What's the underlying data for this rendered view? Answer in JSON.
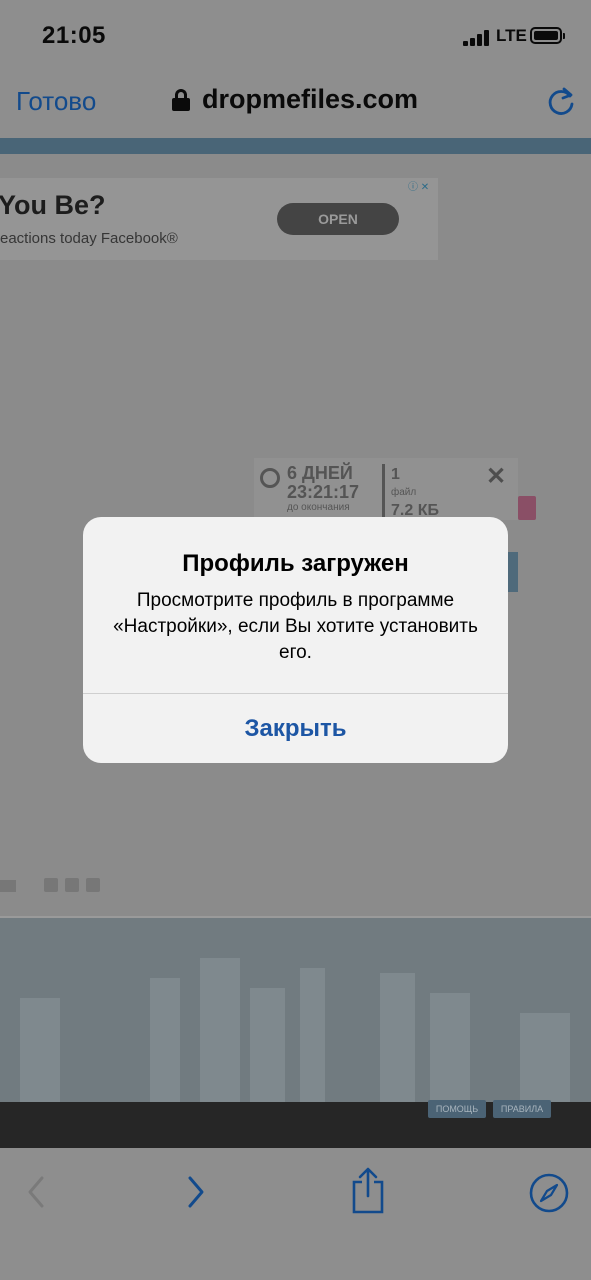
{
  "status": {
    "time": "21:05",
    "network": "LTE"
  },
  "browser": {
    "done_label": "Готово",
    "url": "dropmefiles.com"
  },
  "ad": {
    "title": "You Be?",
    "subtitle": "eactions today Facebook®",
    "button": "OPEN"
  },
  "widget": {
    "days": "6 ДНЕЙ",
    "time": "23:21:17",
    "caption": "до окончания",
    "count": "1",
    "file_label": "файл",
    "size": "7.2 КБ"
  },
  "footer": {
    "help": "ПОМОЩЬ",
    "rules": "ПРАВИЛА"
  },
  "alert": {
    "title": "Профиль загружен",
    "message": "Просмотрите профиль в программе «Настройки», если Вы хотите установить его.",
    "close_button": "Закрыть"
  },
  "colors": {
    "accent": "#1d56a4",
    "dim_accent": "#124a8c"
  },
  "toolbar": {
    "icons": [
      "back-icon",
      "forward-icon",
      "share-icon",
      "safari-compass-icon"
    ]
  }
}
